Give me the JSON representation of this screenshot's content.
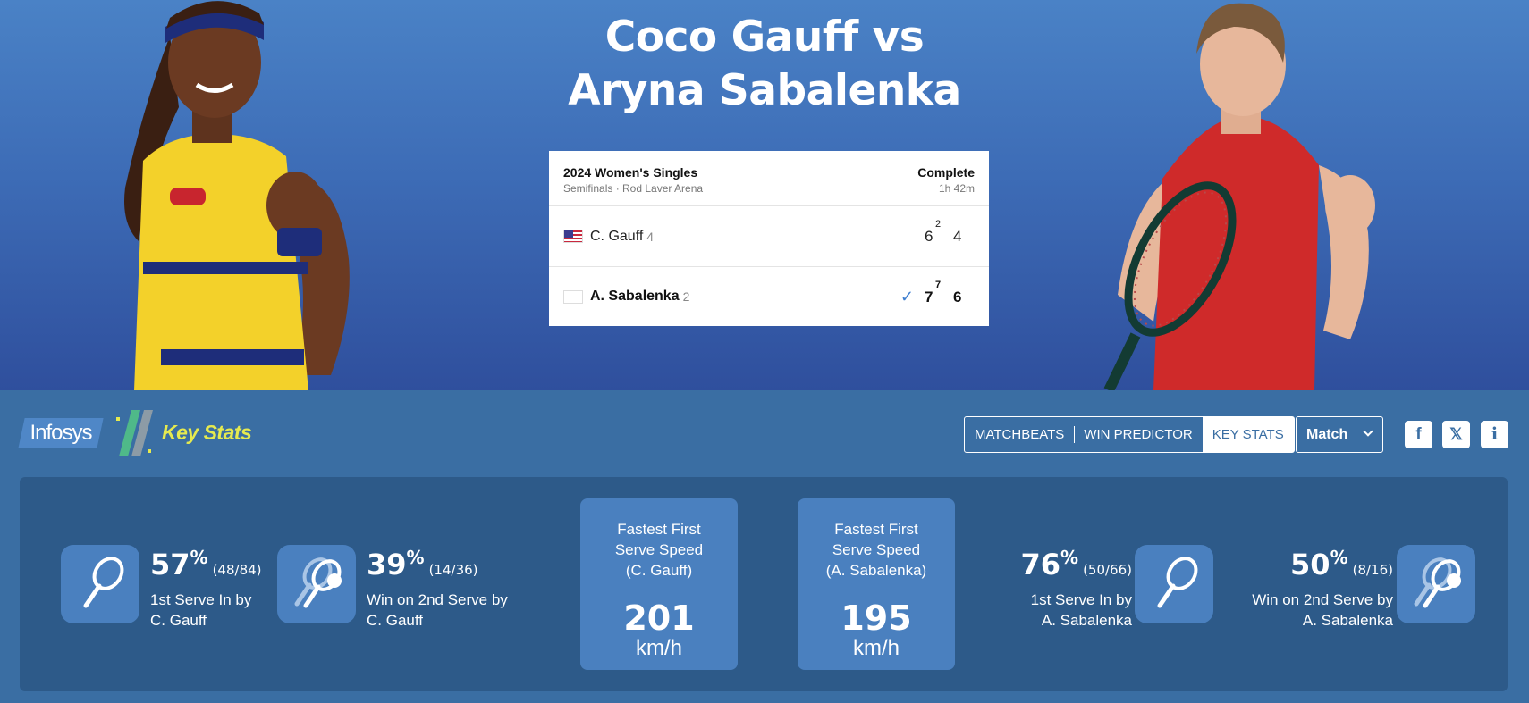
{
  "header": {
    "title_line1": "Coco Gauff vs",
    "title_line2": "Aryna Sabalenka"
  },
  "scorecard": {
    "event": "2024 Women's Singles",
    "round_venue": "Semifinals · Rod Laver Arena",
    "status": "Complete",
    "duration": "1h 42m",
    "players": [
      {
        "name": "C. Gauff",
        "seed": "4",
        "sets": [
          "6",
          "4"
        ],
        "tiebreak": "2",
        "winner": false
      },
      {
        "name": "A. Sabalenka",
        "seed": "2",
        "sets": [
          "7",
          "6"
        ],
        "tiebreak": "7",
        "winner": true
      }
    ],
    "winner_mark": "✓"
  },
  "stats_bar": {
    "infosys_label": "Infosys",
    "key_stats_label": "Key Stats",
    "tabs": [
      "MATCHBEATS",
      "WIN PREDICTOR",
      "KEY STATS"
    ],
    "active_tab": "KEY STATS",
    "dropdown_value": "Match",
    "social": {
      "facebook": "f",
      "x": "𝕏",
      "info": "i"
    }
  },
  "stats": {
    "gauff_first_serve": {
      "value": "57",
      "unit": "%",
      "fraction": "(48/84)",
      "label_line1": "1st Serve In by",
      "label_line2": "C. Gauff"
    },
    "gauff_second_serve": {
      "value": "39",
      "unit": "%",
      "fraction": "(14/36)",
      "label_line1": "Win on 2nd Serve by",
      "label_line2": "C. Gauff"
    },
    "gauff_fastest": {
      "title_line1": "Fastest First",
      "title_line2": "Serve Speed",
      "title_line3": "(C. Gauff)",
      "value": "201",
      "unit": "km/h"
    },
    "sabalenka_fastest": {
      "title_line1": "Fastest First",
      "title_line2": "Serve Speed",
      "title_line3": "(A. Sabalenka)",
      "value": "195",
      "unit": "km/h"
    },
    "sabalenka_first_serve": {
      "value": "76",
      "unit": "%",
      "fraction": "(50/66)",
      "label_line1": "1st Serve In by",
      "label_line2": "A. Sabalenka"
    },
    "sabalenka_second_serve": {
      "value": "50",
      "unit": "%",
      "fraction": "(8/16)",
      "label_line1": "Win on 2nd Serve by",
      "label_line2": "A. Sabalenka"
    }
  },
  "colors": {
    "hero_top": "#4a82c6",
    "hero_bottom": "#2f4f9d",
    "bar_bg": "#3a6ea3",
    "panel_bg": "#2d5a89",
    "tile_bg": "#4a80bf",
    "key_stats_yellow": "#e6ea4f",
    "gauff_kit": "#f3d12a",
    "sabalenka_kit": "#cf2a2a"
  }
}
